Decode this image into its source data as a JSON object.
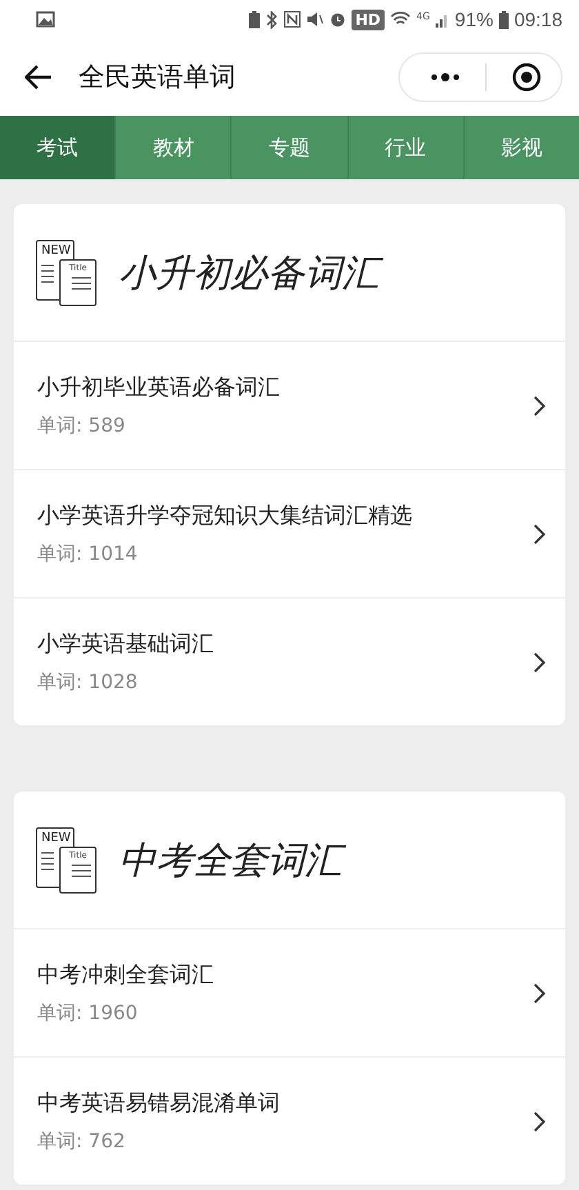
{
  "status_bar": {
    "hd": "HD",
    "network": "4G",
    "battery": "91%",
    "time": "09:18"
  },
  "header": {
    "title": "全民英语单词"
  },
  "tabs": [
    {
      "label": "考试",
      "selected": true
    },
    {
      "label": "教材",
      "selected": false
    },
    {
      "label": "专题",
      "selected": false
    },
    {
      "label": "行业",
      "selected": false
    },
    {
      "label": "影视",
      "selected": false
    }
  ],
  "sections": [
    {
      "badge": "NEW",
      "doc_label": "Title",
      "title": "小升初必备词汇",
      "items": [
        {
          "title": "小升初毕业英语必备词汇",
          "count": "单词: 589"
        },
        {
          "title": "小学英语升学夺冠知识大集结词汇精选",
          "count": "单词: 1014"
        },
        {
          "title": "小学英语基础词汇",
          "count": "单词: 1028"
        }
      ]
    },
    {
      "badge": "NEW",
      "doc_label": "Title",
      "title": "中考全套词汇",
      "items": [
        {
          "title": "中考冲刺全套词汇",
          "count": "单词: 1960"
        },
        {
          "title": "中考英语易错易混淆单词",
          "count": "单词: 762"
        }
      ]
    }
  ]
}
